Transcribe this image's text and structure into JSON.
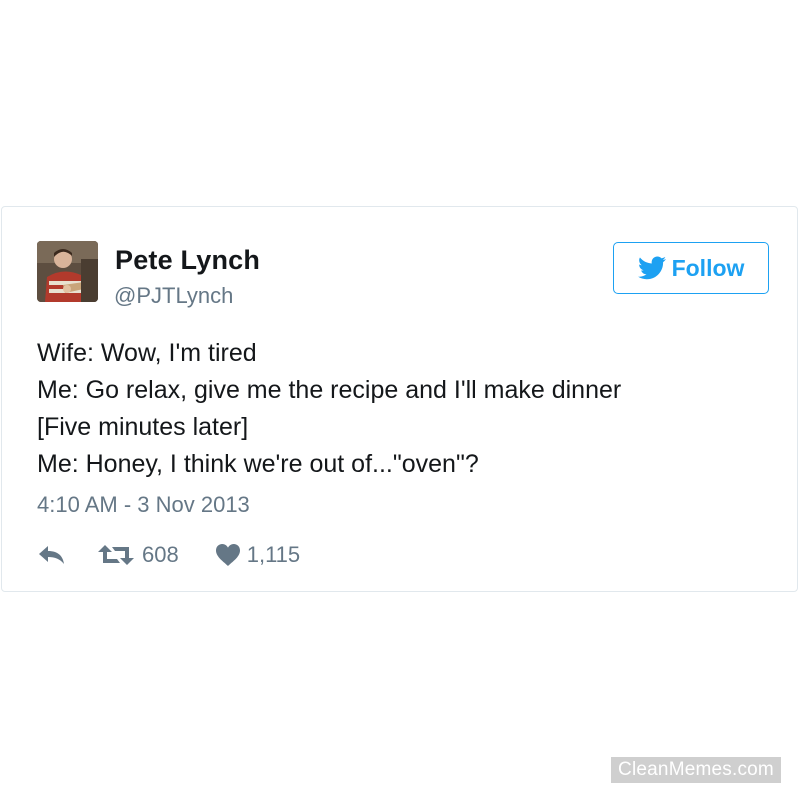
{
  "tweet": {
    "author": {
      "name": "Pete Lynch",
      "handle": "@PJTLynch",
      "avatar_icon": "profile-photo"
    },
    "follow_button": {
      "label": "Follow",
      "icon": "twitter-bird-icon",
      "color": "#1da1f2"
    },
    "text_lines": [
      "Wife: Wow, I'm tired",
      "Me: Go relax, give me the recipe and I'll make dinner",
      "[Five minutes later]",
      "Me: Honey, I think we're out of...\"oven\"?"
    ],
    "timestamp": "4:10 AM - 3 Nov 2013",
    "actions": {
      "reply": {
        "icon": "reply-icon"
      },
      "retweet": {
        "icon": "retweet-icon",
        "count": "608"
      },
      "like": {
        "icon": "heart-icon",
        "count": "1,115"
      }
    }
  },
  "watermark": "CleanMemes.com",
  "colors": {
    "text_primary": "#14171a",
    "text_secondary": "#657786",
    "border": "#e1e8ed",
    "accent": "#1da1f2"
  }
}
